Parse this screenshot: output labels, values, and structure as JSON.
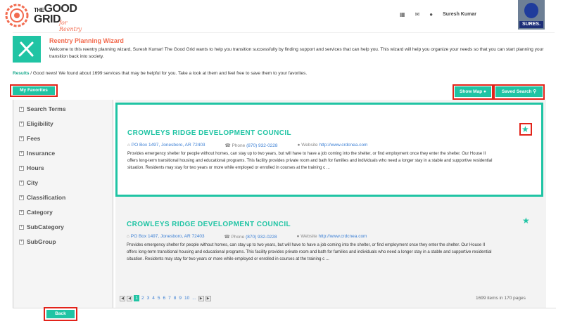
{
  "header": {
    "logo_line1": "THE",
    "logo_line2": "GOOD",
    "logo_line3": "GRID",
    "logo_sub": "for Reentry",
    "user_name": "Suresh Kumar",
    "avatar_tag": "SURES."
  },
  "wizard": {
    "title": "Reentry Planning Wizard",
    "text": "Welcome to this reentry planning wizard, Suresh Kumar! The Good Grid wants to help you transition successfully by finding support and services that can help you. This wizard will help you organize your needs so that you can start planning your transition back into society."
  },
  "results": {
    "label": "Results",
    "text": " / Good news! We found about 1699 services that may be helpful for you. Take a look at them and feel free to save them to your favorites."
  },
  "buttons": {
    "my_favorites": "My Favorites",
    "show_map": "Show Map",
    "saved_search": "Saved Search",
    "back": "Back"
  },
  "filters": [
    "Search Terms",
    "Eligibility",
    "Fees",
    "Insurance",
    "Hours",
    "City",
    "Classification",
    "Category",
    "SubCategory",
    "SubGroup"
  ],
  "listings": [
    {
      "title": "CROWLEYS RIDGE DEVELOPMENT COUNCIL",
      "address": "PO Box 1497,  Jonesboro,  AR  72403",
      "phone_label": "Phone",
      "phone": "(870) 932-0228",
      "website_label": "Website",
      "website": "http://www.crdcnea.com",
      "description": "Provides emergency shelter for people without homes, can stay up to two years, but will have to have a job coming into the shelter, or find employment once they enter the shelter. Our House II offers long-term transitional housing and educational programs. This facility provides private room and bath for families and individuals who need a longer stay in a stable and supportive residential situation. Residents may stay for two years or more while employed or enrolled in courses at the training c ..."
    },
    {
      "title": "CROWLEYS RIDGE DEVELOPMENT COUNCIL",
      "address": "PO Box 1497,  Jonesboro,  AR  72403",
      "phone_label": "Phone",
      "phone": "(870) 932-0228",
      "website_label": "Website",
      "website": "http://www.crdcnea.com",
      "description": "Provides emergency shelter for people without homes, can stay up to two years, but will have to have a job coming into the shelter, or find employment once they enter the shelter. Our House II offers long-term transitional housing and educational programs. This facility provides private room and bath for families and individuals who need a longer stay in a stable and supportive residential situation. Residents may stay for two years or more while employed or enrolled in courses at the training c ..."
    }
  ],
  "pager": {
    "pages": [
      "1",
      "2",
      "3",
      "4",
      "5",
      "6",
      "7",
      "8",
      "9",
      "10",
      "..."
    ],
    "current": "1",
    "info": "1699 items in 170 pages"
  },
  "colors": {
    "accent": "#20c4a4",
    "title": "#f26b4f",
    "highlight": "#e2231a"
  }
}
